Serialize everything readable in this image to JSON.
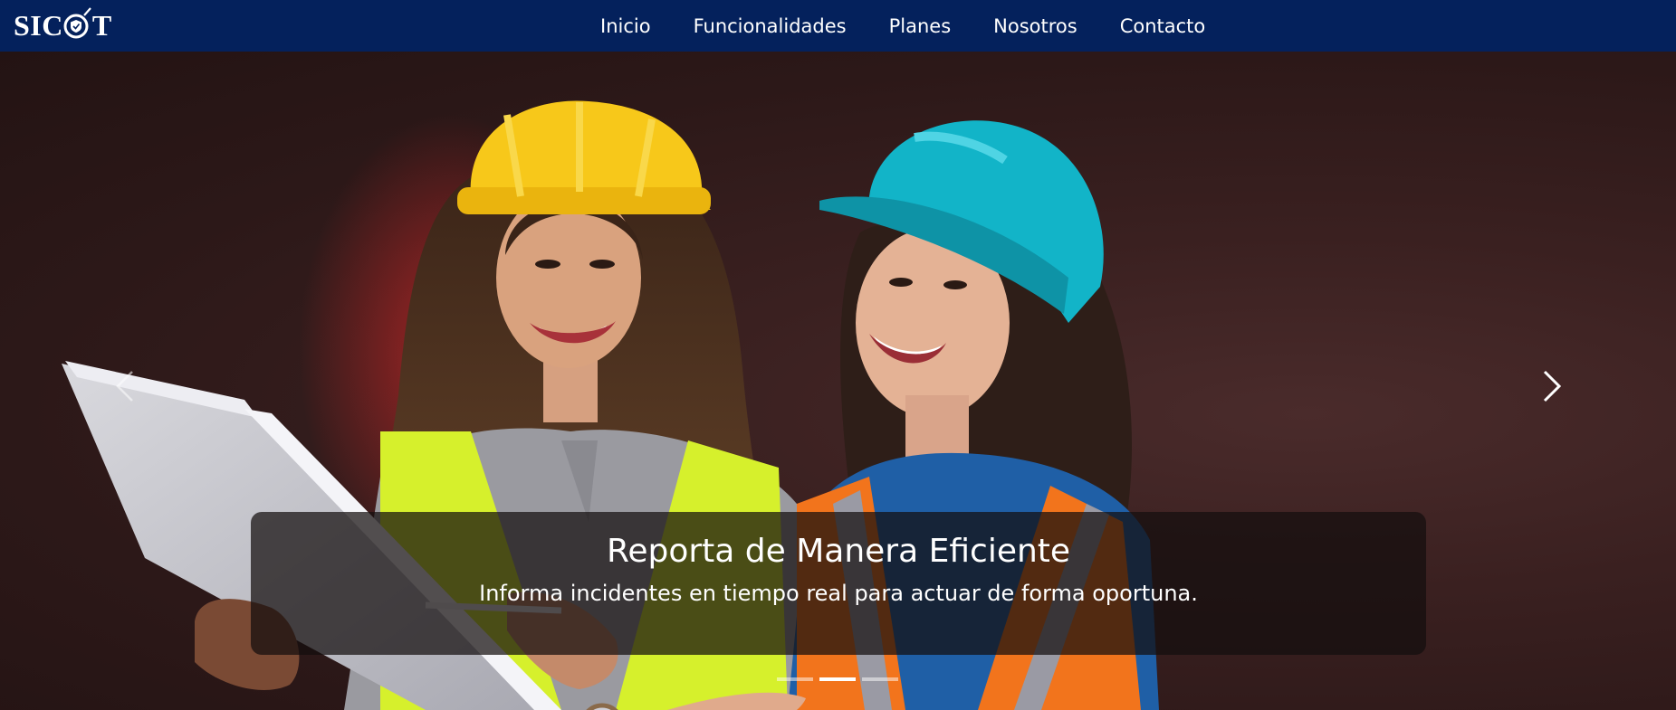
{
  "brand": {
    "logo_text_left": "SIC",
    "logo_text_right": "T"
  },
  "nav": {
    "items": [
      {
        "label": "Inicio"
      },
      {
        "label": "Funcionalidades"
      },
      {
        "label": "Planes"
      },
      {
        "label": "Nosotros"
      },
      {
        "label": "Contacto"
      }
    ]
  },
  "carousel": {
    "caption_title": "Reporta de Manera Eficiente",
    "caption_subtitle": "Informa incidentes en tiempo real para actuar de forma oportuna.",
    "slide_count": 3,
    "active_index": 1,
    "prev_icon": "chevron-left-icon",
    "next_icon": "chevron-right-icon"
  },
  "colors": {
    "navbar_bg": "#04215c",
    "caption_bg": "rgba(20,14,14,0.72)",
    "helmet_yellow": "#f7c81a",
    "helmet_teal": "#12b4c8",
    "vest_lime": "#d6f02c",
    "vest_orange": "#f2741c"
  }
}
